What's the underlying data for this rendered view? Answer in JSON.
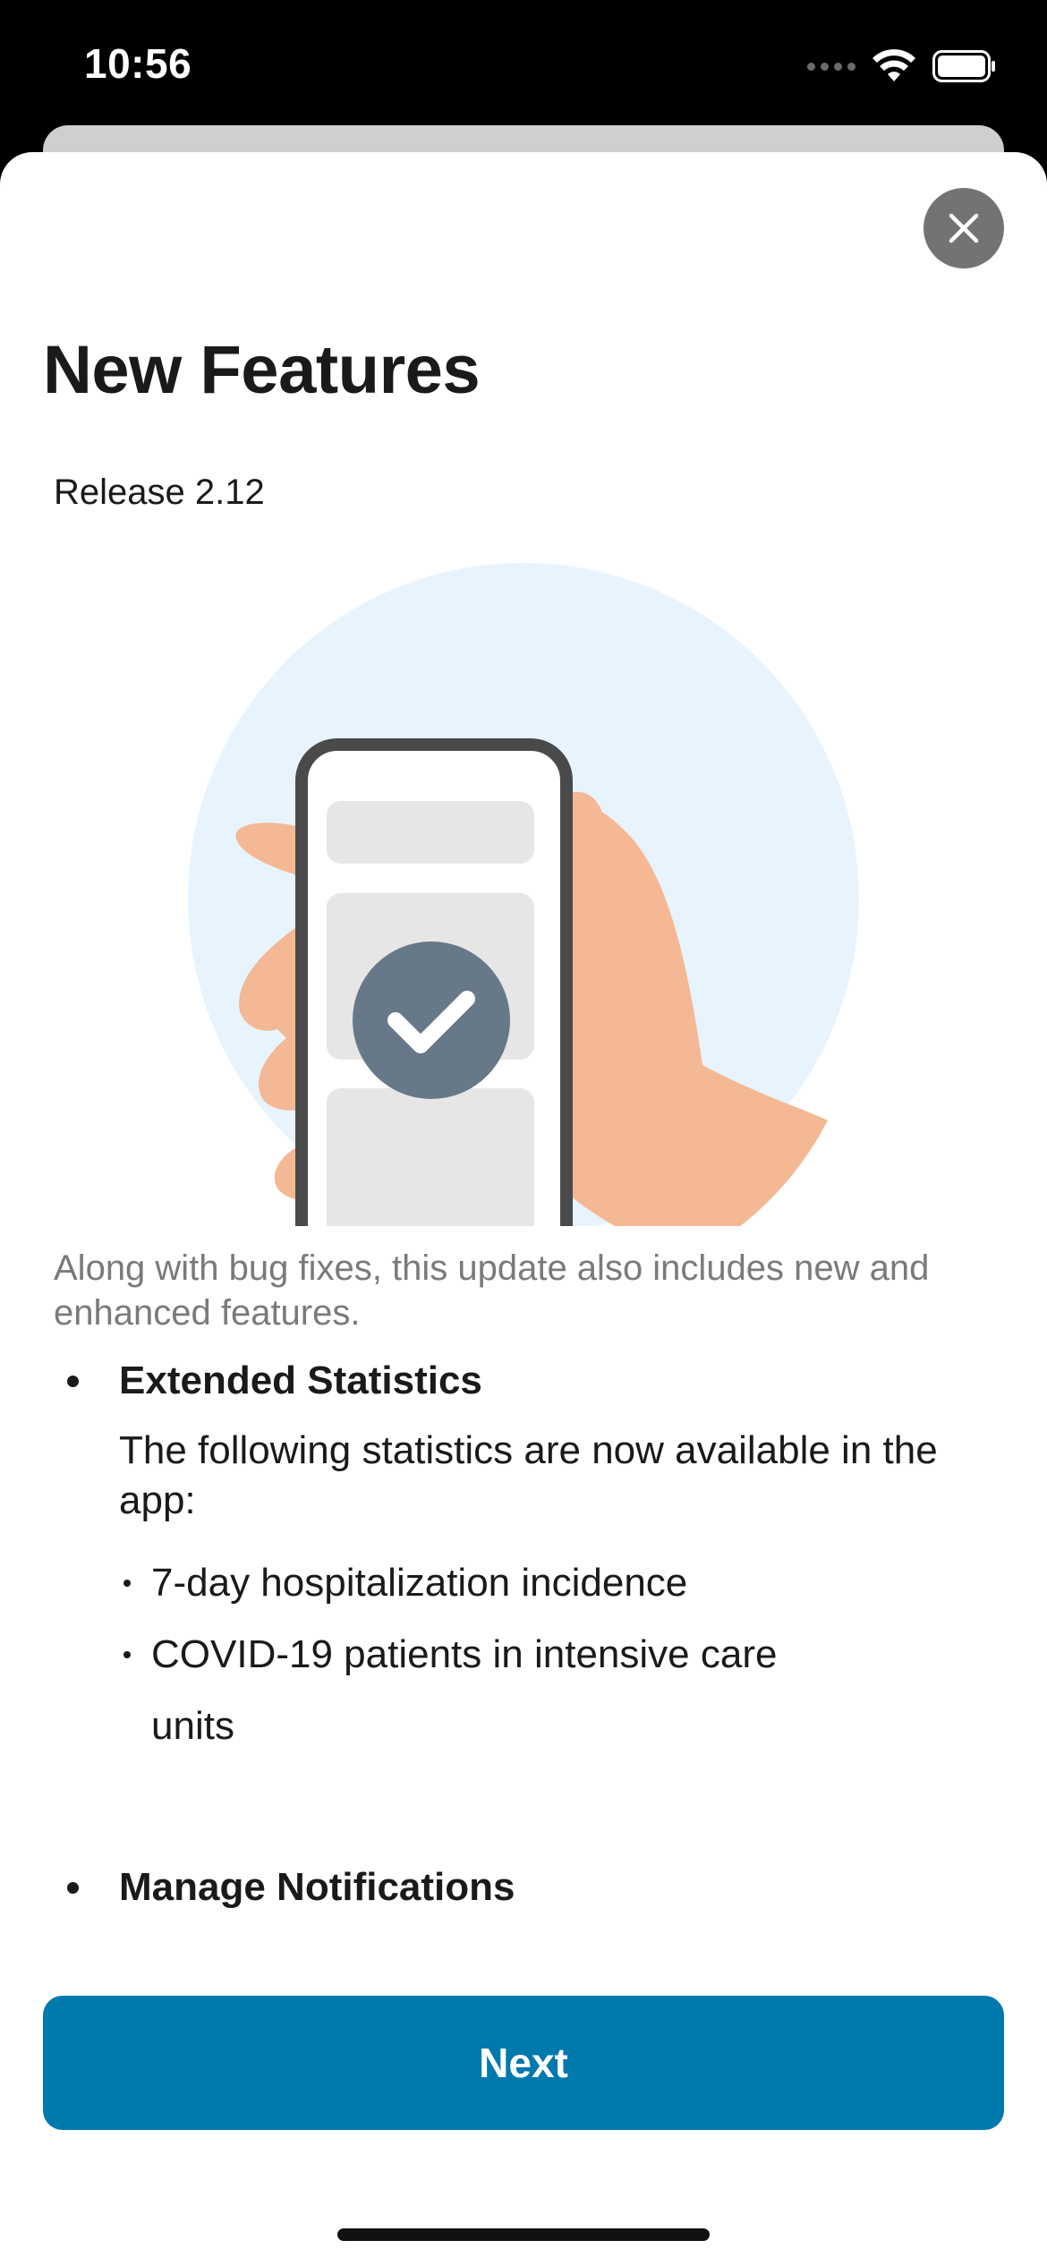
{
  "status_bar": {
    "time": "10:56"
  },
  "header": {
    "title": "New Features",
    "release": "Release 2.12"
  },
  "close_button": {
    "icon": "close-icon"
  },
  "illustration": {
    "description_icon": "phone-checkmark-illustration",
    "colors": {
      "circle": "#e8f4fd",
      "hand": "#f5b894",
      "phone_frame": "#4a4a4a",
      "check_badge": "#677888"
    }
  },
  "intro": {
    "text": "Along with bug fixes, this update also includes new and enhanced features."
  },
  "features": [
    {
      "title": "Extended Statistics",
      "description": "The following statistics are now available in the app:",
      "items": [
        "7-day hospitalization incidence",
        "COVID-19 patients in intensive care units"
      ]
    },
    {
      "title": "Manage Notifications"
    }
  ],
  "footer": {
    "next_label": "Next"
  },
  "colors": {
    "accent": "#0079ad",
    "close_bg": "#737373",
    "secondary_text": "#7a7a7a"
  }
}
